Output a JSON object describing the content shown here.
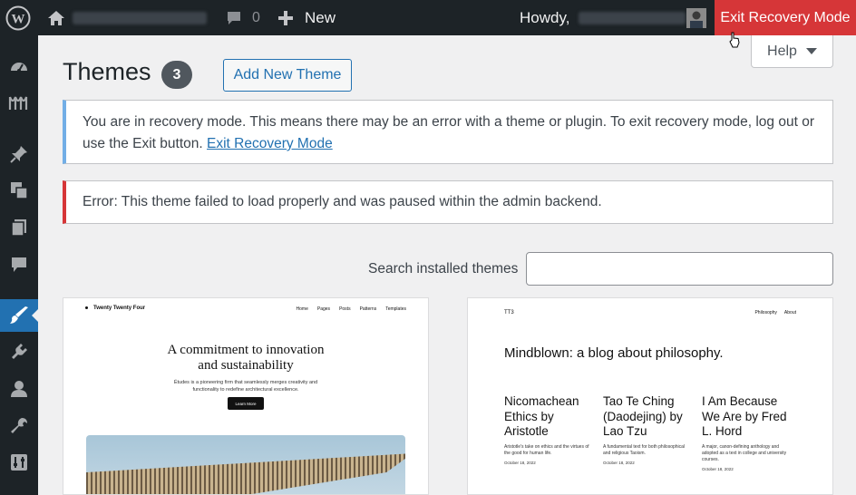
{
  "admin_bar": {
    "comments_count": "0",
    "new_label": "New",
    "howdy": "Howdy,",
    "exit_recovery": "Exit Recovery Mode"
  },
  "sidebar": {
    "icons": [
      "dashboard-icon",
      "jetpack-icon",
      "posts-pin-icon",
      "media-icon",
      "pages-icon",
      "comments-icon",
      "appearance-icon",
      "plugins-icon",
      "users-icon",
      "tools-icon",
      "settings-icon"
    ],
    "active": "appearance-icon"
  },
  "help": {
    "label": "Help"
  },
  "page": {
    "title": "Themes",
    "count": "3",
    "add_new": "Add New Theme"
  },
  "notices": {
    "recovery_text": "You are in recovery mode. This means there may be an error with a theme or plugin. To exit recovery mode, log out or use the Exit button.",
    "recovery_link": "Exit Recovery Mode",
    "error_text": "Error: This theme failed to load properly and was paused within the admin backend."
  },
  "search": {
    "label": "Search installed themes",
    "value": ""
  },
  "themes": [
    {
      "site_title": "Twenty Twenty Four",
      "nav": [
        "Home",
        "Pages",
        "Posts",
        "Patterns",
        "Templates"
      ],
      "headline_1": "A commitment to innovation",
      "headline_2": "and sustainability",
      "subtext": "Études is a pioneering firm that seamlessly merges creativity and functionality to redefine architectural excellence.",
      "button": "Learn More"
    },
    {
      "site_title": "TT3",
      "nav": [
        "Philosophy",
        "About"
      ],
      "headline": "Mindblown: a blog about philosophy.",
      "posts": [
        {
          "title": "Nicomachean Ethics by Aristotle",
          "excerpt": "Aristotle's take on ethics and the virtues of the good for human life.",
          "date": "October 18, 2022"
        },
        {
          "title": "Tao Te Ching (Daodejing) by Lao Tzu",
          "excerpt": "A fundamental text for both philosophical and religious Taoism.",
          "date": "October 18, 2022"
        },
        {
          "title": "I Am Because We Are by Fred L. Hord",
          "excerpt": "A major, canon-defining anthology and adopted as a text in college and university courses.",
          "date": "October 18, 2022"
        }
      ]
    }
  ]
}
